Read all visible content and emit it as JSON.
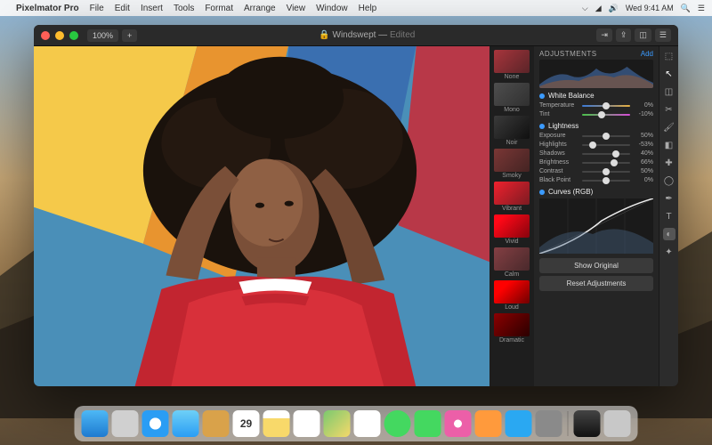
{
  "menubar": {
    "app_name": "Pixelmator Pro",
    "items": [
      "File",
      "Edit",
      "Insert",
      "Tools",
      "Format",
      "Arrange",
      "View",
      "Window",
      "Help"
    ],
    "time": "Wed 9:41 AM"
  },
  "window": {
    "zoom": "100%",
    "title": "Windswept",
    "status": "Edited"
  },
  "presets": [
    {
      "label": "None"
    },
    {
      "label": "Mono"
    },
    {
      "label": "Noir"
    },
    {
      "label": "Smoky"
    },
    {
      "label": "Vibrant"
    },
    {
      "label": "Vivid"
    },
    {
      "label": "Calm"
    },
    {
      "label": "Loud"
    },
    {
      "label": "Dramatic"
    }
  ],
  "adjustments": {
    "header_label": "ADJUSTMENTS",
    "add_label": "Add",
    "white_balance": {
      "title": "White Balance",
      "temperature": {
        "label": "Temperature",
        "value": "0%",
        "pos": 50
      },
      "tint": {
        "label": "Tint",
        "value": "-10%",
        "pos": 40
      }
    },
    "lightness": {
      "title": "Lightness",
      "exposure": {
        "label": "Exposure",
        "value": "50%",
        "pos": 50
      },
      "highlights": {
        "label": "Highlights",
        "value": "-53%",
        "pos": 23
      },
      "shadows": {
        "label": "Shadows",
        "value": "40%",
        "pos": 70
      },
      "brightness": {
        "label": "Brightness",
        "value": "66%",
        "pos": 66
      },
      "contrast": {
        "label": "Contrast",
        "value": "50%",
        "pos": 50
      },
      "blackpoint": {
        "label": "Black Point",
        "value": "0%",
        "pos": 50
      }
    },
    "curves": {
      "title": "Curves (RGB)"
    },
    "show_original": "Show Original",
    "reset": "Reset Adjustments"
  },
  "dock": {
    "icons": [
      {
        "name": "finder",
        "color": "#1e9af0"
      },
      {
        "name": "launchpad",
        "color": "#c8c8c8"
      },
      {
        "name": "safari",
        "color": "#1e8fe8"
      },
      {
        "name": "mail",
        "color": "#3bb4f2"
      },
      {
        "name": "contacts",
        "color": "#d9a24a"
      },
      {
        "name": "calendar",
        "color": "#ffffff"
      },
      {
        "name": "notes",
        "color": "#f8d96a"
      },
      {
        "name": "reminders",
        "color": "#ffffff"
      },
      {
        "name": "maps",
        "color": "#7bc96f"
      },
      {
        "name": "photos",
        "color": "#ffffff"
      },
      {
        "name": "messages",
        "color": "#44d860"
      },
      {
        "name": "facetime",
        "color": "#44d860"
      },
      {
        "name": "itunes",
        "color": "#ec5fa8"
      },
      {
        "name": "ibooks",
        "color": "#ff9a3c"
      },
      {
        "name": "appstore",
        "color": "#2aa8f2"
      },
      {
        "name": "preferences",
        "color": "#8a8a8a"
      },
      {
        "name": "pixelmator",
        "color": "#222"
      }
    ],
    "calendar_day": "29"
  }
}
